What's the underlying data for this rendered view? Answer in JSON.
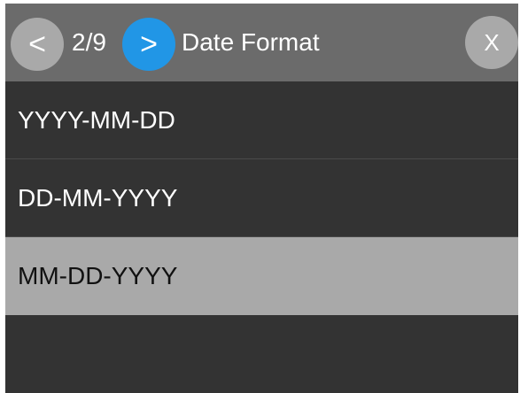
{
  "header": {
    "prev_label": "<",
    "page_counter": "2/9",
    "next_label": ">",
    "title": "Date Format",
    "close_label": "X"
  },
  "options": [
    {
      "label": "YYYY-MM-DD",
      "selected": false
    },
    {
      "label": "DD-MM-YYYY",
      "selected": false
    },
    {
      "label": "MM-DD-YYYY",
      "selected": true
    }
  ],
  "colors": {
    "background": "#333333",
    "header": "#6b6b6b",
    "accent": "#2196e6",
    "button_gray": "#a9a9a9",
    "selected_row": "#a9a9a9"
  }
}
